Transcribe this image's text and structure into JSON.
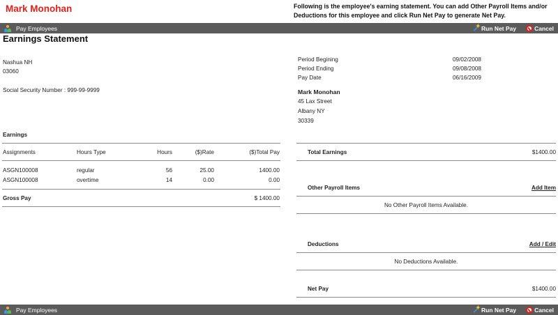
{
  "header": {
    "employee_name": "Mark Monohan",
    "instructions": "Following is the employee's earning statement. You can add Other Payroll Items and/or Deductions for this employee and click Run Net Pay to generate Net Pay."
  },
  "toolbar": {
    "pay_employees_label": "Pay Employees",
    "run_net_pay_label": "Run Net Pay",
    "cancel_label": "Cancel"
  },
  "page_title": "Earnings Statement",
  "employer": {
    "city_state": "Nashua NH",
    "zip": "03060",
    "ssn_label": "Social Security Number :",
    "ssn_value": "999-99-9999"
  },
  "period": {
    "begin_label": "Period Begining",
    "begin_value": "09/02/2008",
    "end_label": "Period Ending",
    "end_value": "09/08/2008",
    "paydate_label": "Pay Date",
    "paydate_value": "06/16/2009"
  },
  "employee_address": {
    "name": "Mark Monohan",
    "street": "45 Lax Street",
    "city_state": "Albany NY",
    "zip": "30339"
  },
  "earnings": {
    "section_label": "Earnings",
    "columns": [
      "Assignments",
      "Hours Type",
      "Hours",
      "($)Rate",
      "($)Total Pay"
    ],
    "rows": [
      [
        "ASGN100008",
        "regular",
        "56",
        "25.00",
        "1400.00"
      ],
      [
        "ASGN100008",
        "overtime",
        "14",
        "0.00",
        "0.00"
      ]
    ],
    "gross_pay_label": "Gross Pay",
    "gross_pay_value": "$ 1400.00"
  },
  "summary": {
    "total_earnings_label": "Total Earnings",
    "total_earnings_value": "$1400.00",
    "other_items_label": "Other Payroll Items",
    "add_item_link": "Add Item",
    "no_other_items": "No Other Payroll Items Available.",
    "deductions_label": "Deductions",
    "add_edit_link": "Add / Edit",
    "no_deductions": "No Deductions Available.",
    "net_pay_label": "Net Pay",
    "net_pay_value": "$1400.00"
  }
}
